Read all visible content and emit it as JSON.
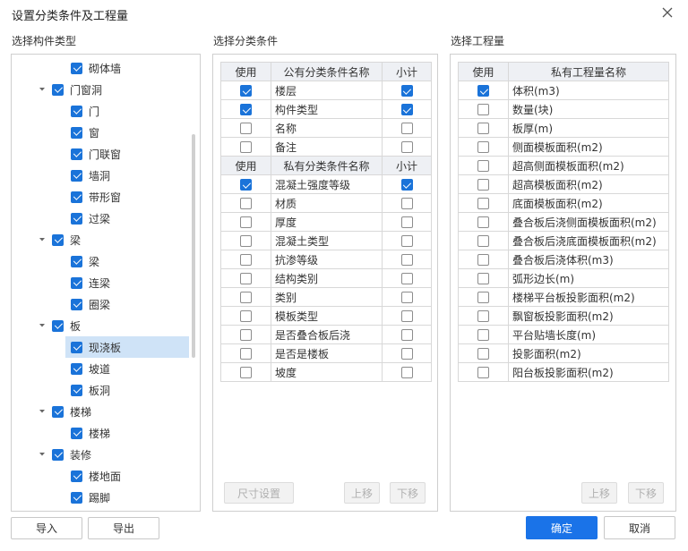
{
  "dialog": {
    "title": "设置分类条件及工程量"
  },
  "sections": {
    "component": "选择构件类型",
    "condition": "选择分类条件",
    "quantity": "选择工程量"
  },
  "tree": [
    {
      "label": "砌体墙",
      "level": 1,
      "checked": true,
      "arrow": false
    },
    {
      "label": "门窗洞",
      "level": 0,
      "checked": true,
      "arrow": true
    },
    {
      "label": "门",
      "level": 1,
      "checked": true,
      "arrow": false
    },
    {
      "label": "窗",
      "level": 1,
      "checked": true,
      "arrow": false
    },
    {
      "label": "门联窗",
      "level": 1,
      "checked": true,
      "arrow": false
    },
    {
      "label": "墙洞",
      "level": 1,
      "checked": true,
      "arrow": false
    },
    {
      "label": "带形窗",
      "level": 1,
      "checked": true,
      "arrow": false
    },
    {
      "label": "过梁",
      "level": 1,
      "checked": true,
      "arrow": false
    },
    {
      "label": "梁",
      "level": 0,
      "checked": true,
      "arrow": true
    },
    {
      "label": "梁",
      "level": 1,
      "checked": true,
      "arrow": false
    },
    {
      "label": "连梁",
      "level": 1,
      "checked": true,
      "arrow": false
    },
    {
      "label": "圈梁",
      "level": 1,
      "checked": true,
      "arrow": false
    },
    {
      "label": "板",
      "level": 0,
      "checked": true,
      "arrow": true
    },
    {
      "label": "现浇板",
      "level": 1,
      "checked": true,
      "arrow": false,
      "selected": true
    },
    {
      "label": "坡道",
      "level": 1,
      "checked": true,
      "arrow": false
    },
    {
      "label": "板洞",
      "level": 1,
      "checked": true,
      "arrow": false
    },
    {
      "label": "楼梯",
      "level": 0,
      "checked": true,
      "arrow": true
    },
    {
      "label": "楼梯",
      "level": 1,
      "checked": true,
      "arrow": false
    },
    {
      "label": "装修",
      "level": 0,
      "checked": true,
      "arrow": true
    },
    {
      "label": "楼地面",
      "level": 1,
      "checked": true,
      "arrow": false
    },
    {
      "label": "踢脚",
      "level": 1,
      "checked": true,
      "arrow": false
    }
  ],
  "conditions": {
    "public_header": {
      "use": "使用",
      "name": "公有分类条件名称",
      "subtotal": "小计"
    },
    "public_rows": [
      {
        "name": "楼层",
        "use": true,
        "subtotal": true
      },
      {
        "name": "构件类型",
        "use": true,
        "subtotal": true
      },
      {
        "name": "名称",
        "use": false,
        "subtotal": false
      },
      {
        "name": "备注",
        "use": false,
        "subtotal": false
      }
    ],
    "private_header": {
      "use": "使用",
      "name": "私有分类条件名称",
      "subtotal": "小计"
    },
    "private_rows": [
      {
        "name": "混凝土强度等级",
        "use": true,
        "subtotal": true
      },
      {
        "name": "材质",
        "use": false,
        "subtotal": false
      },
      {
        "name": "厚度",
        "use": false,
        "subtotal": false
      },
      {
        "name": "混凝土类型",
        "use": false,
        "subtotal": false
      },
      {
        "name": "抗渗等级",
        "use": false,
        "subtotal": false
      },
      {
        "name": "结构类别",
        "use": false,
        "subtotal": false
      },
      {
        "name": "类别",
        "use": false,
        "subtotal": false
      },
      {
        "name": "模板类型",
        "use": false,
        "subtotal": false
      },
      {
        "name": "是否叠合板后浇",
        "use": false,
        "subtotal": false
      },
      {
        "name": "是否是楼板",
        "use": false,
        "subtotal": false
      },
      {
        "name": "坡度",
        "use": false,
        "subtotal": false
      }
    ]
  },
  "quantities": {
    "header": {
      "use": "使用",
      "name": "私有工程量名称"
    },
    "rows": [
      {
        "name": "体积(m3)",
        "use": true
      },
      {
        "name": "数量(块)",
        "use": false
      },
      {
        "name": "板厚(m)",
        "use": false
      },
      {
        "name": "侧面模板面积(m2)",
        "use": false
      },
      {
        "name": "超高侧面模板面积(m2)",
        "use": false
      },
      {
        "name": "超高模板面积(m2)",
        "use": false
      },
      {
        "name": "底面模板面积(m2)",
        "use": false
      },
      {
        "name": "叠合板后浇侧面模板面积(m2)",
        "use": false
      },
      {
        "name": "叠合板后浇底面模板面积(m2)",
        "use": false
      },
      {
        "name": "叠合板后浇体积(m3)",
        "use": false
      },
      {
        "name": "弧形边长(m)",
        "use": false
      },
      {
        "name": "楼梯平台板投影面积(m2)",
        "use": false
      },
      {
        "name": "飘窗板投影面积(m2)",
        "use": false
      },
      {
        "name": "平台贴墙长度(m)",
        "use": false
      },
      {
        "name": "投影面积(m2)",
        "use": false
      },
      {
        "name": "阳台板投影面积(m2)",
        "use": false
      }
    ]
  },
  "buttons": {
    "size_settings": "尺寸设置",
    "up": "上移",
    "down": "下移",
    "import": "导入",
    "export": "导出",
    "ok": "确定",
    "cancel": "取消"
  },
  "colors": {
    "accent": "#1a73e8",
    "checkbox": "#1a73d9",
    "selected_row": "#cfe3f7"
  }
}
